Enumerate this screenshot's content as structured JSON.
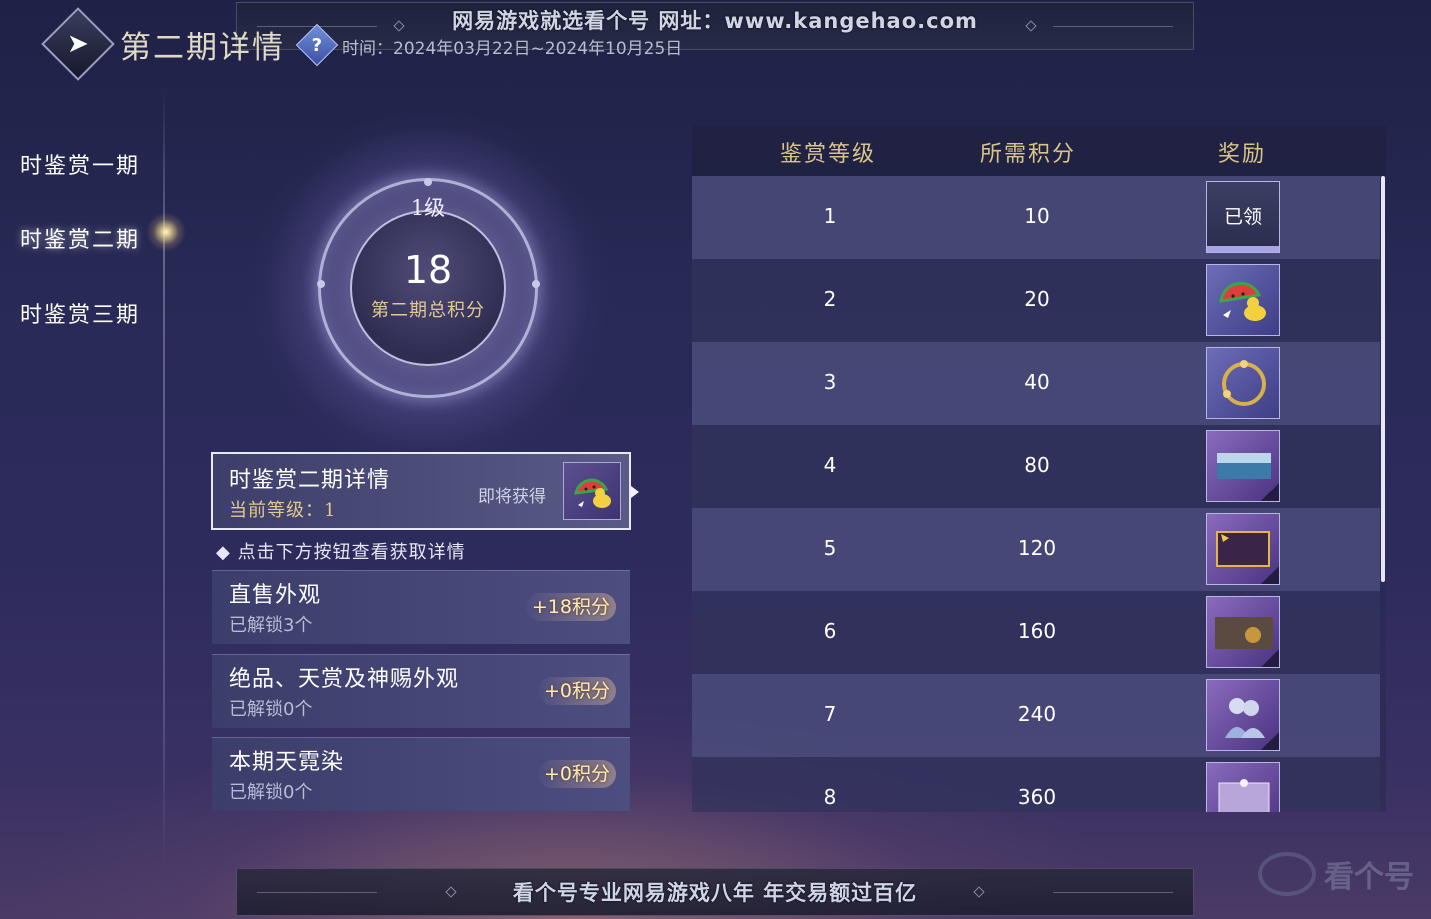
{
  "watermark_top": "网易游戏就选看个号  网址：www.kangehao.com",
  "watermark_bottom": "看个号专业网易游戏八年  年交易额过百亿",
  "header": {
    "title": "第二期详情",
    "help_icon": "question-icon",
    "time": "时间：2024年03月22日~2024年10月25日"
  },
  "sidebar": {
    "items": [
      {
        "label": "时鉴赏一期"
      },
      {
        "label": "时鉴赏二期",
        "active": true
      },
      {
        "label": "时鉴赏三期"
      }
    ]
  },
  "score_ring": {
    "level": "1级",
    "score": "18",
    "label": "第二期总积分"
  },
  "detail_card": {
    "title": "时鉴赏二期详情",
    "current_level": "当前等级：1",
    "upcoming": "即将获得",
    "reward_icon": "watermelon-duck-icon"
  },
  "hint": "◆ 点击下方按钮查看获取详情",
  "categories": [
    {
      "name": "直售外观",
      "unlocked": "已解锁3个",
      "points": "+18积分"
    },
    {
      "name": "绝品、天赏及神赐外观",
      "unlocked": "已解锁0个",
      "points": "+0积分"
    },
    {
      "name": "本期天霓染",
      "unlocked": "已解锁0个",
      "points": "+0积分"
    }
  ],
  "table": {
    "headers": [
      "鉴赏等级",
      "所需积分",
      "奖励"
    ],
    "rows": [
      {
        "level": "1",
        "points": "10",
        "reward": "已领",
        "icon": "claimed"
      },
      {
        "level": "2",
        "points": "20",
        "icon": "watermelon-duck-icon"
      },
      {
        "level": "3",
        "points": "40",
        "icon": "golden-ring-icon"
      },
      {
        "level": "4",
        "points": "80",
        "icon": "scenery-card-icon"
      },
      {
        "level": "5",
        "points": "120",
        "icon": "golden-frame-icon"
      },
      {
        "level": "6",
        "points": "160",
        "icon": "mech-scene-icon"
      },
      {
        "level": "7",
        "points": "240",
        "icon": "couple-portrait-icon"
      },
      {
        "level": "8",
        "points": "360",
        "icon": "ornate-frame-icon"
      }
    ]
  },
  "brand_watermark": "看个号",
  "colors": {
    "gold": "#d9c48a",
    "score_gold": "#e2c98f",
    "background": "#292a57"
  }
}
